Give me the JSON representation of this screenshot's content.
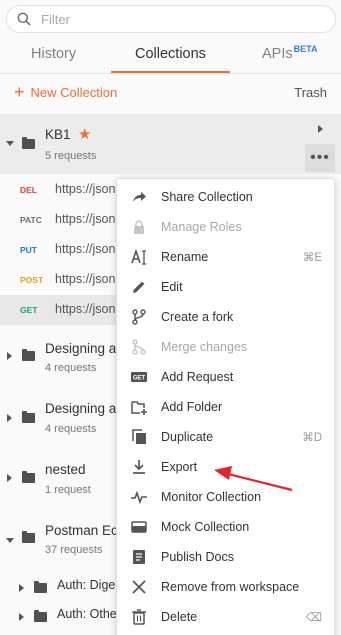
{
  "search": {
    "placeholder": "Filter"
  },
  "tabs": [
    {
      "label": "History"
    },
    {
      "label": "Collections"
    },
    {
      "label": "APIs",
      "badge": "BETA"
    }
  ],
  "actions": {
    "new_collection": "New Collection",
    "trash": "Trash"
  },
  "collections": [
    {
      "name": "KB1",
      "sub": "5 requests",
      "starred": true
    },
    {
      "name": "Designing a",
      "sub": "4 requests"
    },
    {
      "name": "Designing a",
      "sub": "4 requests"
    },
    {
      "name": "nested",
      "sub": "1 request"
    },
    {
      "name": "Postman Ec",
      "sub": "37 requests"
    }
  ],
  "requests": [
    {
      "method": "DEL",
      "color": "#e03e3e",
      "url": "https://json"
    },
    {
      "method": "PATC",
      "color": "#707070",
      "url": "https://json"
    },
    {
      "method": "PUT",
      "color": "#2479d0",
      "url": "https://json"
    },
    {
      "method": "POST",
      "color": "#e8a21a",
      "url": "https://json"
    },
    {
      "method": "GET",
      "color": "#1aa469",
      "url": "https://json"
    }
  ],
  "subfolders": [
    {
      "name": "Auth: Dige"
    },
    {
      "name": "Auth: Othe"
    }
  ],
  "menu": [
    {
      "label": "Share Collection",
      "icon": "share-icon"
    },
    {
      "label": "Manage Roles",
      "icon": "lock-icon",
      "disabled": true
    },
    {
      "label": "Rename",
      "icon": "rename-icon",
      "shortcut": "⌘E"
    },
    {
      "label": "Edit",
      "icon": "pencil-icon"
    },
    {
      "label": "Create a fork",
      "icon": "fork-icon"
    },
    {
      "label": "Merge changes",
      "icon": "merge-icon",
      "disabled": true
    },
    {
      "label": "Add Request",
      "icon": "get-request-icon",
      "icon_text": "GET"
    },
    {
      "label": "Add Folder",
      "icon": "add-folder-icon"
    },
    {
      "label": "Duplicate",
      "icon": "duplicate-icon",
      "shortcut": "⌘D"
    },
    {
      "label": "Export",
      "icon": "download-icon"
    },
    {
      "label": "Monitor Collection",
      "icon": "pulse-icon"
    },
    {
      "label": "Mock Collection",
      "icon": "server-icon"
    },
    {
      "label": "Publish Docs",
      "icon": "doc-icon"
    },
    {
      "label": "Remove from workspace",
      "icon": "close-icon"
    },
    {
      "label": "Delete",
      "icon": "trash-icon",
      "shortcut": "⌫"
    }
  ],
  "colors": {
    "accent": "#f26b3a",
    "annotation": "#e0262d"
  }
}
